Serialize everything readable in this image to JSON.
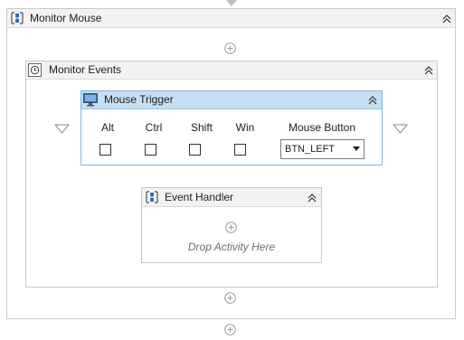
{
  "top_arrow": "down-triangle-icon",
  "monitor_mouse": {
    "title": "Monitor Mouse"
  },
  "monitor_events": {
    "title": "Monitor Events"
  },
  "mouse_trigger": {
    "title": "Mouse Trigger",
    "modifiers": [
      {
        "label": "Alt",
        "checked": false
      },
      {
        "label": "Ctrl",
        "checked": false
      },
      {
        "label": "Shift",
        "checked": false
      },
      {
        "label": "Win",
        "checked": false
      }
    ],
    "mouse_button_label": "Mouse Button",
    "mouse_button_value": "BTN_LEFT"
  },
  "event_handler": {
    "title": "Event Handler",
    "drop_placeholder": "Drop Activity Here"
  },
  "colors": {
    "trigger_header_bg": "#c6dff3",
    "trigger_border": "#7fb3dd",
    "panel_border": "#c9c9c9",
    "header_bg": "#f2f2f2",
    "sequence_icon_blue": "#2f6fb5"
  }
}
